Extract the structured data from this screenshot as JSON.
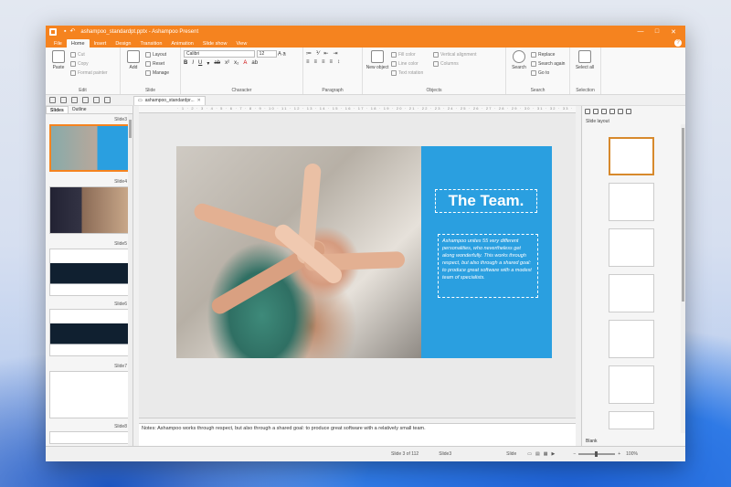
{
  "window": {
    "title": "ashampoo_standardpt.pptx - Ashampoo Present"
  },
  "menu": {
    "tabs": [
      "File",
      "Home",
      "Insert",
      "Design",
      "Transition",
      "Animation",
      "Slide show",
      "View"
    ],
    "active": "Home"
  },
  "ribbon": {
    "edit": {
      "label": "Edit",
      "paste": "Paste",
      "cut": "Cut",
      "copy": "Copy",
      "format_painter": "Format painter"
    },
    "slide": {
      "label": "Slide",
      "add": "Add",
      "layout": "Layout",
      "reset": "Reset",
      "manage": "Manage"
    },
    "character": {
      "label": "Character",
      "font": "Calibri",
      "size": "12"
    },
    "paragraph": {
      "label": "Paragraph"
    },
    "objects": {
      "label": "Objects",
      "new_object": "New object",
      "fill_color": "Fill color",
      "line_color": "Line color",
      "text_rotation": "Text rotation",
      "vertical_alignment": "Vertical alignment",
      "columns": "Columns"
    },
    "search": {
      "label": "Search",
      "search": "Search",
      "replace": "Replace",
      "search_again": "Search again",
      "goto": "Go to"
    },
    "selection": {
      "label": "Selection",
      "select_all": "Select all"
    }
  },
  "doc_tab": "ashampoo_standardpr...",
  "slides_panel": {
    "tabs": [
      "Slides",
      "Outline"
    ],
    "labels": [
      "Slide3",
      "Slide4",
      "Slide5",
      "Slide6",
      "Slide7",
      "Slide8"
    ]
  },
  "slide": {
    "heading": "The Team.",
    "body": "Ashampoo unites 55 very different personalities, who nevertheless get along wonderfully. This works through respect, but also through a shared goal: to produce great software with a modest team of specialists."
  },
  "notes": "Notes: Ashampoo works through respect, but also through a shared goal: to produce great software with a relatively small team.",
  "right_panel": {
    "title": "Slide layout",
    "footer": "Blank"
  },
  "status": {
    "slide_pos": "Slide 3 of 112",
    "slide_name": "Slide3",
    "lang": "Slide",
    "zoom": "100%"
  },
  "colors": {
    "accent": "#f5831f",
    "slide_blue": "#2a9fe0"
  }
}
